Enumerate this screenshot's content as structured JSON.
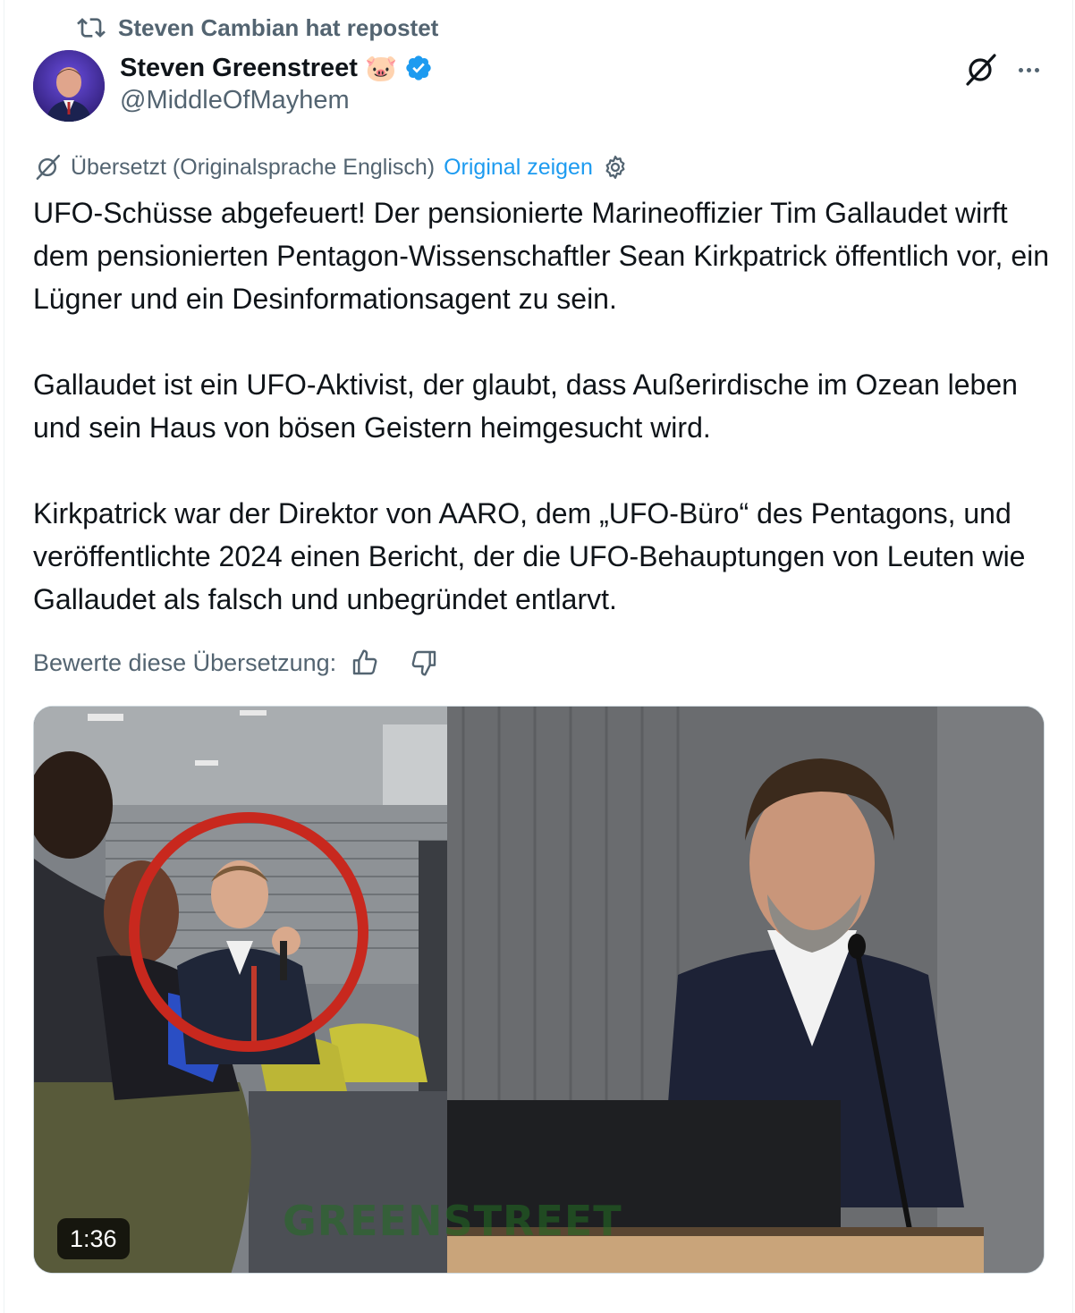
{
  "repost": {
    "label": "Steven Cambian hat repostet"
  },
  "author": {
    "name": "Steven Greenstreet",
    "emoji": "🐷",
    "handle": "@MiddleOfMayhem"
  },
  "translation": {
    "note": "Übersetzt (Originalsprache Englisch)",
    "show_original": "Original zeigen"
  },
  "tweet": {
    "paragraphs": [
      "UFO-Schüsse abgefeuert! Der pensionierte Marineoffizier Tim Gallaudet wirft dem pensionierten Pentagon-Wissenschaftler Sean Kirkpatrick öffentlich vor, ein Lügner und ein Desinformationsagent zu sein.",
      "Gallaudet ist ein UFO-Aktivist, der glaubt, dass Außerirdische im Ozean leben und sein Haus von bösen Geistern heimgesucht wird.",
      "Kirkpatrick war der Direktor von AARO, dem „UFO-Büro“ des Pentagons, und veröffentlichte 2024 einen Bericht, der die UFO-Behauptungen von Leuten wie Gallaudet als falsch und unbegründet entlarvt."
    ]
  },
  "rating": {
    "label": "Bewerte diese Übersetzung:"
  },
  "video": {
    "duration": "1:36",
    "watermark": "GREENSTREET"
  },
  "colors": {
    "link": "#1d9bf0",
    "secondary_text": "#536471",
    "verified": "#1d9bf0",
    "highlight_circle": "#c8281e"
  }
}
